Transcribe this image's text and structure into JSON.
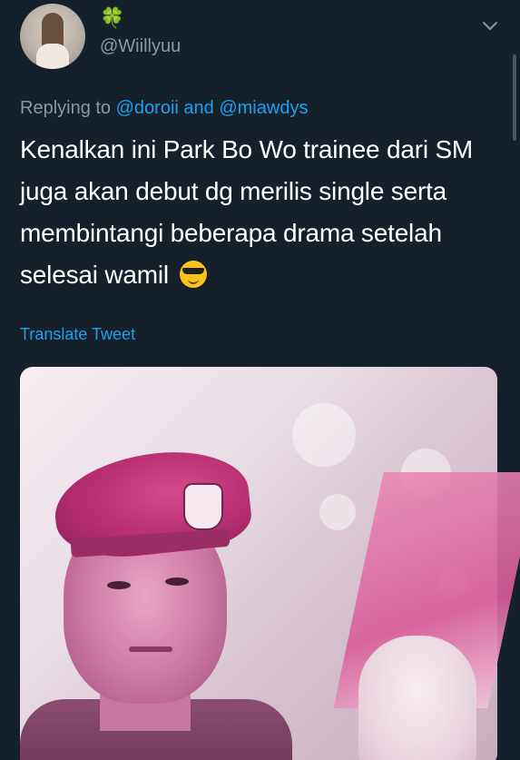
{
  "header": {
    "display_name_emoji": "🍀",
    "username": "@Wiillyuu"
  },
  "reply": {
    "prefix": "Replying to",
    "mention_1": "@doroii",
    "conjunction": "and",
    "mention_2": "@miawdys"
  },
  "tweet": {
    "line_1": "Kenalkan ini Park Bo Wo trainee dari SM",
    "line_2": "juga akan debut dg merilis single serta",
    "line_3": "membintangi beberapa drama setelah",
    "line_4": "selesai wamil"
  },
  "translate_label": "Translate Tweet",
  "icons": {
    "menu": "chevron-down-icon",
    "emoji": "smiling-face-with-sunglasses"
  },
  "colors": {
    "background": "#15202b",
    "accent": "#1da1f2",
    "secondary_text": "#8899a6"
  }
}
